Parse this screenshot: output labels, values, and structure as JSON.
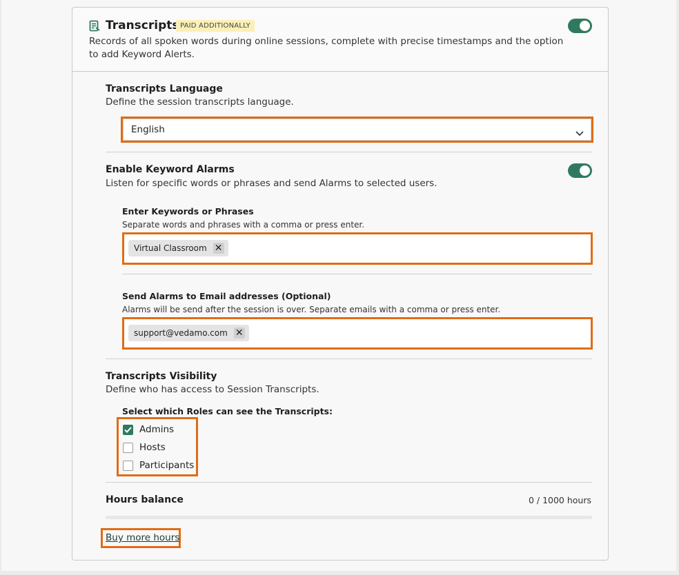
{
  "header": {
    "title": "Transcripts",
    "badge": "PAID ADDITIONALLY",
    "description": "Records of all spoken words during online sessions, complete with precise timestamps and the option to add Keyword Alerts.",
    "enabled": true
  },
  "language": {
    "title": "Transcripts Language",
    "description": "Define the session transcripts language.",
    "selected": "English"
  },
  "keyword_alarms": {
    "title": "Enable Keyword Alarms",
    "description": "Listen for specific words or phrases and send Alarms to selected users.",
    "enabled": true,
    "keywords": {
      "label": "Enter Keywords or Phrases",
      "hint": "Separate words and phrases with a comma or press enter.",
      "chips": [
        "Virtual Classroom"
      ]
    },
    "emails": {
      "label": "Send Alarms to Email addresses (Optional)",
      "hint": "Alarms will be send after the session is over. Separate emails with a comma or press enter.",
      "chips": [
        "support@vedamo.com"
      ]
    }
  },
  "visibility": {
    "title": "Transcripts Visibility",
    "description": "Define who has access to Session Transcripts.",
    "roles_label": "Select which Roles can see the Transcripts:",
    "roles": [
      {
        "label": "Admins",
        "checked": true
      },
      {
        "label": "Hosts",
        "checked": false
      },
      {
        "label": "Participants",
        "checked": false
      }
    ]
  },
  "hours": {
    "title": "Hours balance",
    "value": "0 / 1000 hours",
    "used_fraction": 0,
    "buy_link": "Buy more hours"
  },
  "colors": {
    "accent": "#2f7a5e",
    "highlight": "#e06c14",
    "badge_bg": "#fbefb7"
  }
}
